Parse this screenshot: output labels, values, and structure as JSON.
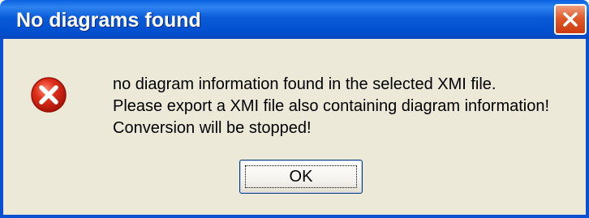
{
  "window": {
    "title": "No diagrams found"
  },
  "message": {
    "lines": [
      "no diagram information found in the selected XMI file.",
      "Please export a XMI file also containing diagram information!",
      "Conversion will be stopped!"
    ],
    "icon": "error-icon"
  },
  "buttons": {
    "ok_label": "OK"
  },
  "colors": {
    "titlebar": "#0054e3",
    "client": "#ece9d8",
    "close_button": "#e05a2a",
    "error_icon": "#d42a1a"
  }
}
